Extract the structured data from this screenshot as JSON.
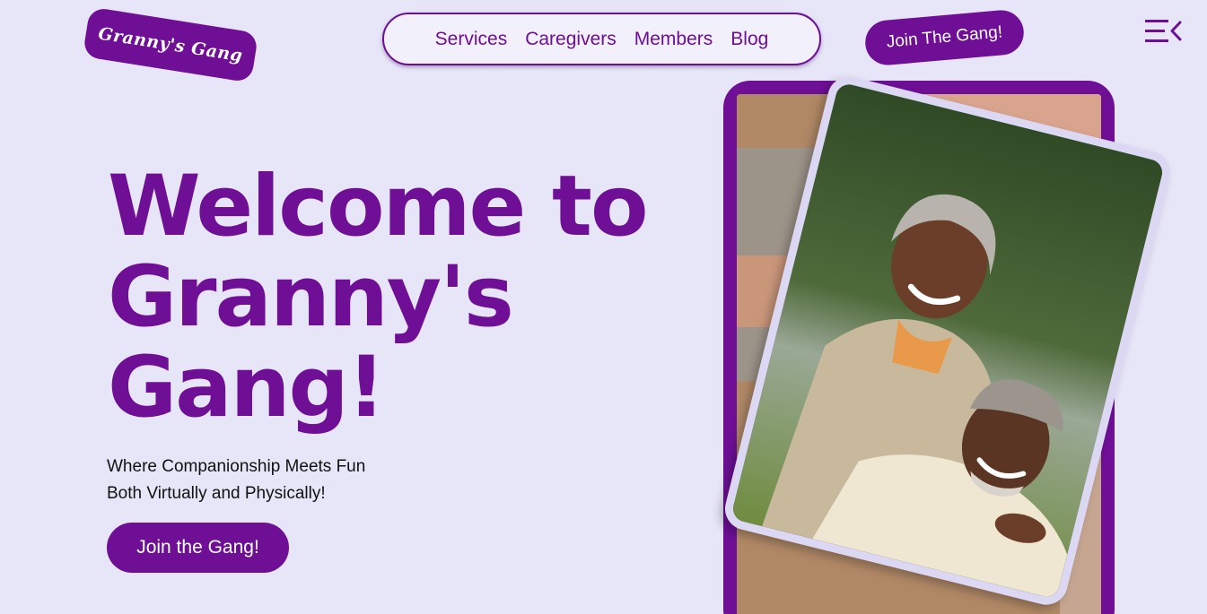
{
  "brand": {
    "logo_text": "Granny's Gang"
  },
  "nav": {
    "items": [
      {
        "label": "Services"
      },
      {
        "label": "Caregivers"
      },
      {
        "label": "Members"
      },
      {
        "label": "Blog"
      }
    ]
  },
  "header": {
    "join_label": "Join The Gang!",
    "menu_icon": "menu-collapse-icon"
  },
  "hero": {
    "title_lines": [
      "Welcome to",
      "Granny's",
      "Gang!"
    ],
    "tagline_lines": [
      "Where Companionship Meets Fun",
      "Both Virtually and Physically!"
    ],
    "cta_label": "Join the Gang!"
  },
  "colors": {
    "background": "#e6e6f8",
    "accent": "#6e0f96",
    "card_border": "#dcd8f4"
  },
  "images": {
    "hero_photo": "elderly-couple-laughing-outdoors"
  }
}
